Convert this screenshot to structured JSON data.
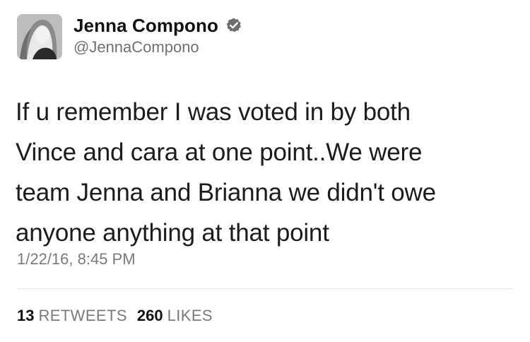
{
  "user": {
    "display_name": "Jenna Compono",
    "handle": "@JennaCompono",
    "verified_icon": "verified-badge-icon"
  },
  "tweet": {
    "text_lines": [
      "If u remember I was voted in by both",
      "Vince and cara at one point..We were",
      "team Jenna and Brianna we didn't owe",
      "anyone anything at that point"
    ],
    "timestamp": "1/22/16, 8:45 PM"
  },
  "stats": {
    "retweets_count": "13",
    "retweets_label": "RETWEETS",
    "likes_count": "260",
    "likes_label": "LIKES"
  },
  "colors": {
    "name": "#111111",
    "secondary": "#7a7a7a",
    "divider": "#e6e6e6"
  }
}
